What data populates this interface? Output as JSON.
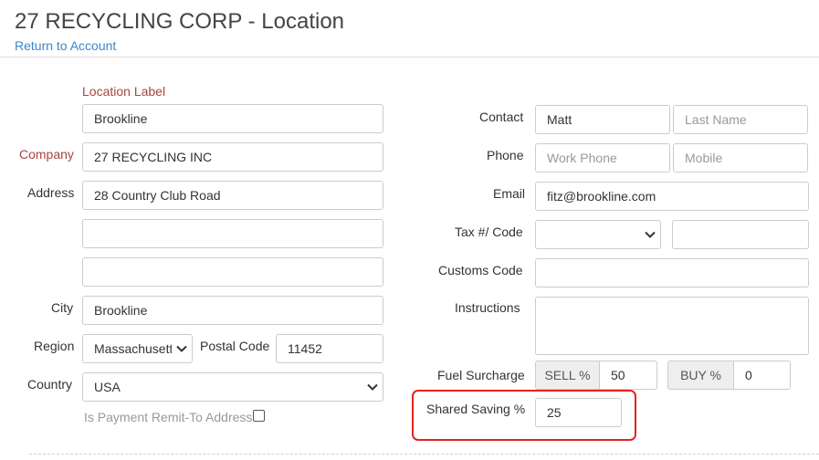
{
  "header": {
    "title": "27 RECYCLING CORP - Location",
    "back_link": "Return to Account"
  },
  "colors": {
    "link": "#3a87c8",
    "required_label": "#a94442",
    "highlight": "#e32222"
  },
  "left": {
    "location_label": {
      "label": "Location Label",
      "value": "Brookline"
    },
    "company": {
      "label": "Company",
      "value": "27 RECYCLING INC"
    },
    "address": {
      "label": "Address",
      "line1": "28 Country Club Road",
      "line2": "",
      "line3": ""
    },
    "city": {
      "label": "City",
      "value": "Brookline"
    },
    "region": {
      "label": "Region",
      "value": "Massachusett"
    },
    "postal": {
      "label": "Postal Code",
      "value": "11452"
    },
    "country": {
      "label": "Country",
      "value": "USA"
    },
    "remit": {
      "label": "Is Payment Remit-To Address",
      "checked": false
    }
  },
  "right": {
    "contact": {
      "label": "Contact",
      "first": "Matt",
      "last_placeholder": "Last Name"
    },
    "phone": {
      "label": "Phone",
      "work_placeholder": "Work Phone",
      "mobile_placeholder": "Mobile"
    },
    "email": {
      "label": "Email",
      "value": "fitz@brookline.com"
    },
    "tax": {
      "label": "Tax #/ Code",
      "select_value": "",
      "code_value": ""
    },
    "customs": {
      "label": "Customs Code",
      "value": ""
    },
    "instructions": {
      "label": "Instructions",
      "value": ""
    },
    "fuel": {
      "label": "Fuel Surcharge",
      "sell_label": "SELL %",
      "sell_value": "50",
      "buy_label": "BUY %",
      "buy_value": "0"
    },
    "shared_saving": {
      "label": "Shared Saving %",
      "value": "25"
    }
  }
}
